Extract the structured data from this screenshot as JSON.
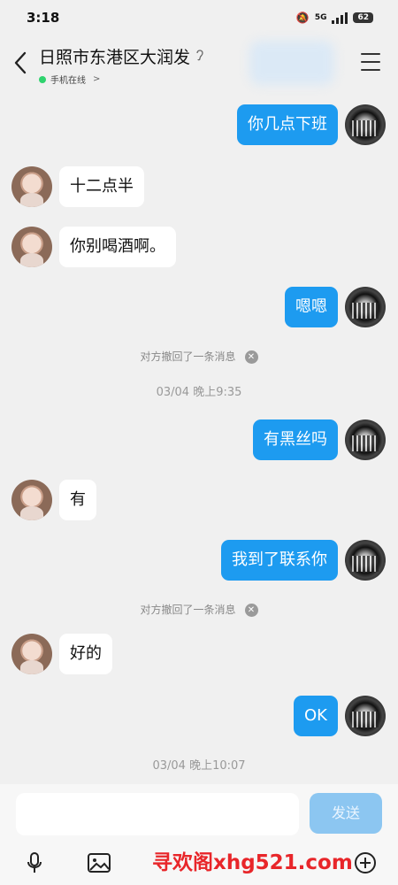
{
  "status_bar": {
    "time": "3:18",
    "network": "5G",
    "battery": "62"
  },
  "header": {
    "title": "日照市东港区大润发",
    "online_status": "手机在线",
    "online_chevron": ">"
  },
  "messages": [
    {
      "side": "out",
      "text": "你几点下班"
    },
    {
      "side": "in",
      "text": "十二点半"
    },
    {
      "side": "in",
      "text": "你别喝酒啊。"
    },
    {
      "side": "out",
      "text": "嗯嗯"
    },
    {
      "side": "system",
      "text": "对方撤回了一条消息"
    },
    {
      "side": "time",
      "text": "03/04 晚上9:35"
    },
    {
      "side": "out",
      "text": "有黑丝吗"
    },
    {
      "side": "in",
      "text": "有"
    },
    {
      "side": "out",
      "text": "我到了联系你"
    },
    {
      "side": "system",
      "text": "对方撤回了一条消息"
    },
    {
      "side": "in",
      "text": "好的"
    },
    {
      "side": "out",
      "text": "OK"
    },
    {
      "side": "time",
      "text": "03/04 晚上10:07"
    }
  ],
  "composer": {
    "send_label": "发送",
    "input_value": ""
  },
  "toolbar": {
    "icons": [
      "microphone-icon",
      "image-icon",
      "add-icon"
    ]
  },
  "watermark": "寻欢阁xhg521.com",
  "colors": {
    "outgoing_bubble": "#1d9bf0",
    "send_button": "#8cc6f1",
    "online_dot": "#2fd36e"
  }
}
